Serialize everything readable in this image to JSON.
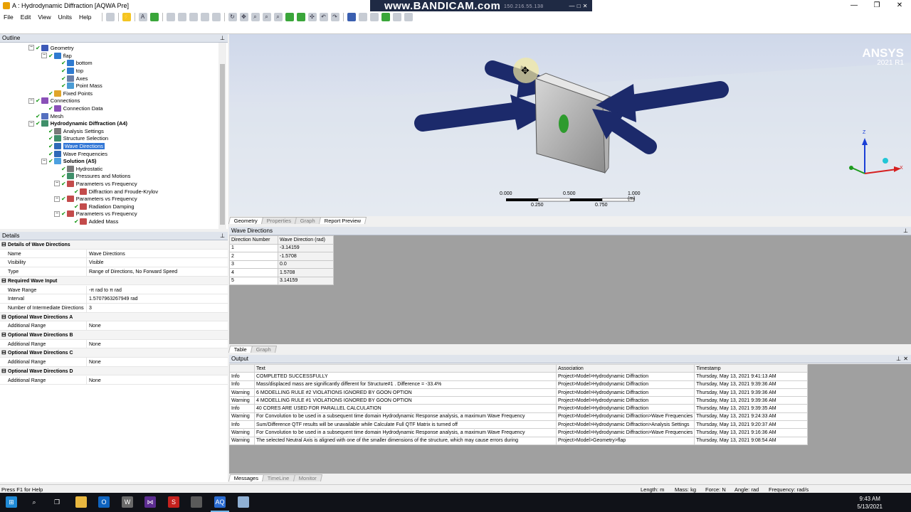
{
  "window": {
    "title": "A : Hydrodynamic Diffraction [AQWA Pre]",
    "controls": [
      "—",
      "❐",
      "✕"
    ]
  },
  "overlay": {
    "watermark": "www.BANDICAM.com",
    "ip": "150.216.55.138"
  },
  "menu": [
    "File",
    "Edit",
    "View",
    "Units",
    "Help"
  ],
  "outline": {
    "title": "Outline",
    "items": [
      {
        "label": "Geometry",
        "icon": "geometry-icon"
      },
      {
        "label": "flap",
        "icon": "body-icon"
      },
      {
        "label": "bottom",
        "icon": "surface-icon"
      },
      {
        "label": "top",
        "icon": "surface-icon"
      },
      {
        "label": "Axes",
        "icon": "axes-icon"
      },
      {
        "label": "Point Mass",
        "icon": "point-mass-icon"
      },
      {
        "label": "Fixed Points",
        "icon": "fixed-points-icon"
      },
      {
        "label": "Connections",
        "icon": "connections-icon"
      },
      {
        "label": "Connection Data",
        "icon": "connection-data-icon"
      },
      {
        "label": "Mesh",
        "icon": "mesh-icon"
      },
      {
        "label": "Hydrodynamic Diffraction (A4)",
        "icon": "hydrodynamic-icon"
      },
      {
        "label": "Analysis Settings",
        "icon": "analysis-settings-icon"
      },
      {
        "label": "Structure Selection",
        "icon": "structure-selection-icon"
      },
      {
        "label": "Wave Directions",
        "icon": "wave-directions-icon"
      },
      {
        "label": "Wave Frequencies",
        "icon": "wave-frequencies-icon"
      },
      {
        "label": "Solution (A5)",
        "icon": "solution-icon"
      },
      {
        "label": "Hydrostatic",
        "icon": "hydrostatic-icon"
      },
      {
        "label": "Pressures and Motions",
        "icon": "pressures-icon"
      },
      {
        "label": "Parameters vs Frequency",
        "icon": "graph-icon"
      },
      {
        "label": "Diffraction and Froude-Krylov",
        "icon": "result-icon"
      },
      {
        "label": "Parameters vs Frequency",
        "icon": "graph-icon"
      },
      {
        "label": "Radiation Damping",
        "icon": "result-icon"
      },
      {
        "label": "Parameters vs Frequency",
        "icon": "graph-icon"
      },
      {
        "label": "Added Mass",
        "icon": "result-icon"
      }
    ]
  },
  "details": {
    "title": "Details",
    "rows": [
      {
        "group": "Details of Wave Directions"
      },
      {
        "key": "Name",
        "value": "Wave Directions"
      },
      {
        "key": "Visibility",
        "value": "Visible"
      },
      {
        "key": "Type",
        "value": "Range of Directions, No Forward Speed"
      },
      {
        "group": "Required Wave Input"
      },
      {
        "key": "Wave Range",
        "value": "-π rad to π rad"
      },
      {
        "key": "Interval",
        "value": "1.5707963267949 rad"
      },
      {
        "key": "Number of Intermediate Directions",
        "value": "3"
      },
      {
        "group": "Optional Wave Directions A"
      },
      {
        "key": "Additional Range",
        "value": "None"
      },
      {
        "group": "Optional Wave Directions B"
      },
      {
        "key": "Additional Range",
        "value": "None"
      },
      {
        "group": "Optional Wave Directions C"
      },
      {
        "key": "Additional Range",
        "value": "None"
      },
      {
        "group": "Optional Wave Directions D"
      },
      {
        "key": "Additional Range",
        "value": "None"
      }
    ]
  },
  "viewport": {
    "logo": "ANSYS",
    "version": "2021 R1",
    "scale_labels": [
      "0.000",
      "0.500",
      "1.000 (m)",
      "0.250",
      "0.750"
    ],
    "axis_z": "Z",
    "axis_x": "X",
    "tabs": [
      "Geometry",
      "Properties",
      "Graph",
      "Report Preview"
    ]
  },
  "wave_directions": {
    "title": "Wave Directions",
    "columns": [
      "Direction Number",
      "Wave Direction (rad)"
    ],
    "rows": [
      [
        "1",
        "-3.14159"
      ],
      [
        "2",
        "-1.5708"
      ],
      [
        "3",
        "0.0"
      ],
      [
        "4",
        "1.5708"
      ],
      [
        "5",
        "3.14159"
      ]
    ],
    "tabs": [
      "Table",
      "Graph"
    ]
  },
  "output": {
    "title": "Output",
    "columns": [
      "",
      "Text",
      "Association",
      "Timestamp"
    ],
    "rows": [
      [
        "Info",
        "COMPLETED SUCCESSFULLY",
        "Project>Model>Hydrodynamic Diffraction",
        "Thursday, May 13, 2021 9:41:13 AM"
      ],
      [
        "Info",
        "Mass/displaced mass are significantly different for Structure#1 . Difference = -33.4%",
        "Project>Model>Hydrodynamic Diffraction",
        "Thursday, May 13, 2021 9:39:36 AM"
      ],
      [
        "Warning",
        "6 MODELLING RULE #2 VIOLATIONS IGNORED BY GOON OPTION",
        "Project>Model>Hydrodynamic Diffraction",
        "Thursday, May 13, 2021 9:39:36 AM"
      ],
      [
        "Warning",
        "4 MODELLING RULE #1 VIOLATIONS IGNORED BY GOON OPTION",
        "Project>Model>Hydrodynamic Diffraction",
        "Thursday, May 13, 2021 9:39:36 AM"
      ],
      [
        "Info",
        "40 CORES ARE USED FOR PARALLEL CALCULATION",
        "Project>Model>Hydrodynamic Diffraction",
        "Thursday, May 13, 2021 9:39:35 AM"
      ],
      [
        "Warning",
        "For Convolution to be used in a subsequent time domain Hydrodynamic Response analysis, a maximum Wave Frequency",
        "Project>Model>Hydrodynamic Diffraction>Wave Frequencies",
        "Thursday, May 13, 2021 9:24:33 AM"
      ],
      [
        "Info",
        "Sum/Difference QTF results will be unavailable while Calculate Full QTF Matrix is turned off",
        "Project>Model>Hydrodynamic Diffraction>Analysis Settings",
        "Thursday, May 13, 2021 9:20:37 AM"
      ],
      [
        "Warning",
        "For Convolution to be used in a subsequent time domain Hydrodynamic Response analysis, a maximum Wave Frequency",
        "Project>Model>Hydrodynamic Diffraction>Wave Frequencies",
        "Thursday, May 13, 2021 9:16:36 AM"
      ],
      [
        "Warning",
        "The selected Neutral Axis is aligned with one of the smaller dimensions of the structure, which may cause errors during",
        "Project>Model>Geometry>flap",
        "Thursday, May 13, 2021 9:08:54 AM"
      ]
    ],
    "tabs": [
      "Messages",
      "TimeLine",
      "Monitor"
    ]
  },
  "status": {
    "help": "Press F1 for Help",
    "length": "Length: m",
    "mass": "Mass: kg",
    "force": "Force: N",
    "angle": "Angle: rad",
    "frequency": "Frequency: rad/s"
  },
  "taskbar": {
    "time": "9:43 AM",
    "date": "5/13/2021"
  }
}
